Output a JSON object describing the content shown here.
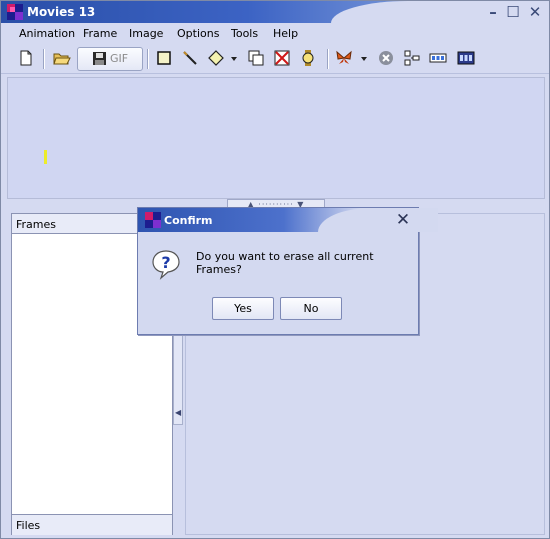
{
  "window": {
    "title": "Movies 13"
  },
  "menu": {
    "items": [
      {
        "label": "Animation"
      },
      {
        "label": "Frame"
      },
      {
        "label": "Image"
      },
      {
        "label": "Options"
      },
      {
        "label": "Tools"
      },
      {
        "label": "Help"
      }
    ]
  },
  "toolbar": {
    "gif_label": "GIF",
    "icons": [
      "new-file-icon",
      "open-folder-icon",
      "save-icon",
      "rectangle-icon",
      "line-icon",
      "diamond-icon",
      "dropdown-arrow-icon",
      "duplicate-frame-icon",
      "delete-frame-icon",
      "watch-icon",
      "butterfly-icon",
      "dropdown-arrow-icon",
      "stop-icon",
      "align-icon",
      "frames-strip-icon",
      "film-strip-icon"
    ]
  },
  "panels": {
    "frames_label": "Frames",
    "files_label": "Files"
  },
  "dialog": {
    "title": "Confirm",
    "message": "Do you want to erase all current Frames?",
    "yes": "Yes",
    "no": "No",
    "icon": "question-icon"
  },
  "colors": {
    "title_bar": "#2a4fa8",
    "window_bg": "#d5daf1",
    "canvas_bg": "#d0d6f2"
  }
}
